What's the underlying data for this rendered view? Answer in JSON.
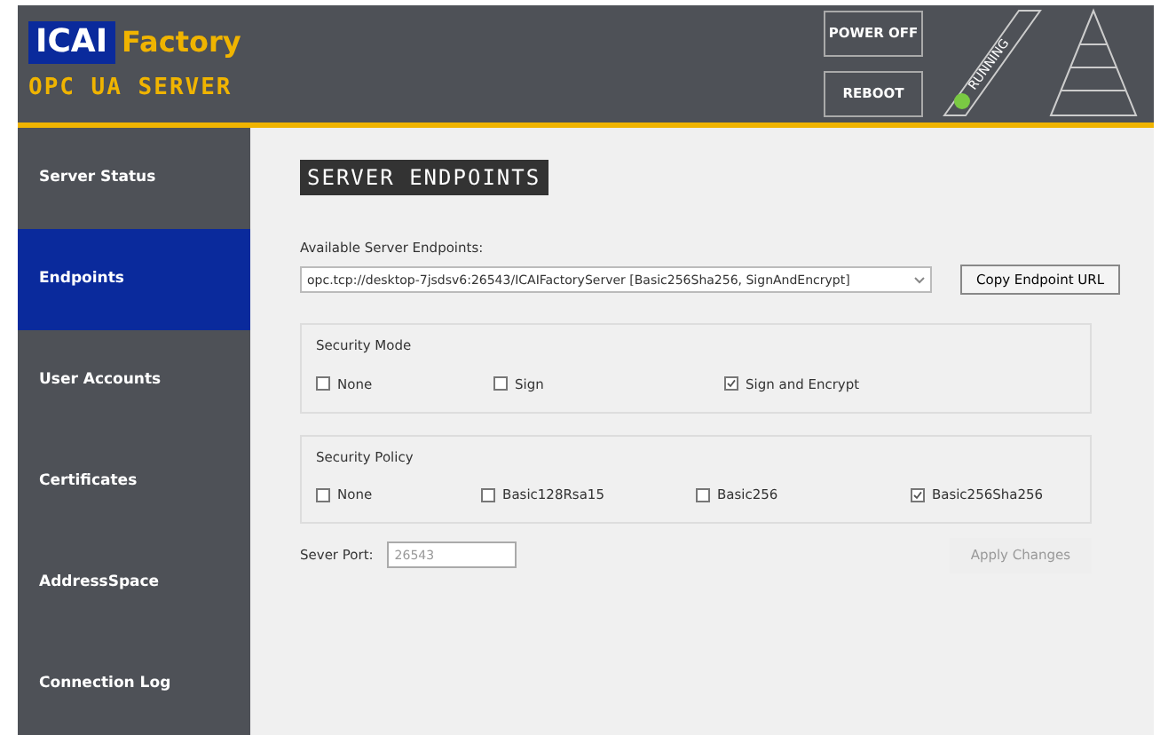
{
  "header": {
    "logo_box": "ICAI",
    "logo_word": "Factory",
    "subtitle": "OPC UA SERVER",
    "buttons": [
      {
        "label": "POWER OFF"
      },
      {
        "label": "REBOOT"
      }
    ],
    "status": {
      "label": "RUNNING",
      "on": true
    }
  },
  "sidebar": {
    "items": [
      {
        "label": "Server Status",
        "selected": false
      },
      {
        "label": "Endpoints",
        "selected": true
      },
      {
        "label": "User Accounts",
        "selected": false
      },
      {
        "label": "Certificates",
        "selected": false
      },
      {
        "label": "AddressSpace",
        "selected": false
      },
      {
        "label": "Connection Log",
        "selected": false
      }
    ]
  },
  "page_title": "SERVER ENDPOINTS",
  "endpoints": {
    "label": "Available Server Endpoints:",
    "value": "opc.tcp://desktop-7jsdsv6:26543/ICAIFactoryServer [Basic256Sha256, SignAndEncrypt]",
    "button": "Copy Endpoint URL"
  },
  "groups": [
    {
      "title": "Security Mode",
      "options": [
        {
          "label": "None",
          "checked": false
        },
        {
          "label": "Sign",
          "checked": false
        },
        {
          "label": "Sign and Encrypt",
          "checked": true
        }
      ]
    },
    {
      "title": "Security Policy",
      "options": [
        {
          "label": "None",
          "checked": false
        },
        {
          "label": "Basic128Rsa15",
          "checked": false
        },
        {
          "label": "Basic256",
          "checked": false
        },
        {
          "label": "Basic256Sha256",
          "checked": true
        }
      ]
    }
  ],
  "port": {
    "label": "Sever Port:",
    "value": "26543",
    "disabled": true
  },
  "apply_button": {
    "label": "Apply Changes",
    "disabled": true
  }
}
